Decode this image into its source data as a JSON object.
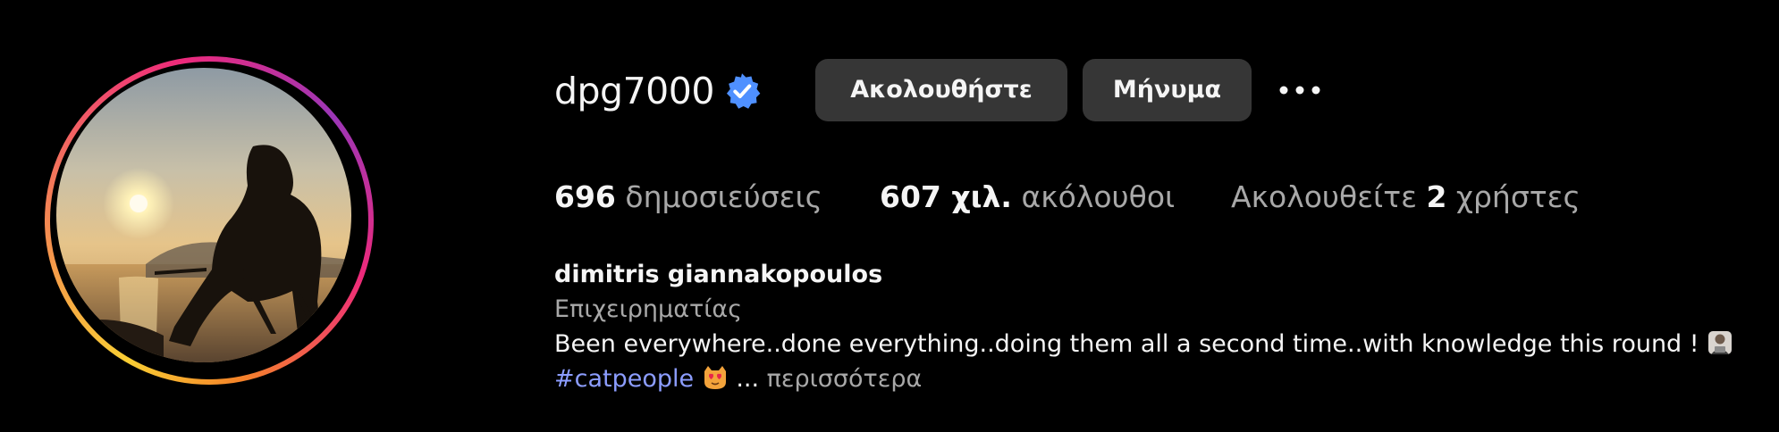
{
  "profile": {
    "username": "dpg7000",
    "verified": true,
    "accent_color": "#4f90ff"
  },
  "actions": {
    "follow_label": "Ακολουθήστε",
    "message_label": "Μήνυμα",
    "more_icon": "more-horizontal-icon"
  },
  "stats": {
    "posts_count": "696",
    "posts_label": "δημοσιεύσεις",
    "followers_count": "607 χιλ.",
    "followers_label": "ακόλουθοι",
    "following_prefix": "Ακολουθείτε",
    "following_count": "2",
    "following_suffix": "χρήστες"
  },
  "bio": {
    "full_name": "dimitris giannakopoulos",
    "category": "Επιχειρηματίας",
    "text_line1": "Been everywhere..done everything..doing them all a second time..with knowledge this round !",
    "hashtag": "#catpeople",
    "ellipsis": "...",
    "more_label": "περισσότερα",
    "emoji_1": "man-technologist-emoji",
    "emoji_2": "heart-eyes-cat-emoji"
  },
  "colors": {
    "background": "#000000",
    "button_bg": "#363636",
    "primary_text": "#f5f5f5",
    "secondary_text": "#a8a8a8",
    "hashtag": "#8c9dff"
  }
}
